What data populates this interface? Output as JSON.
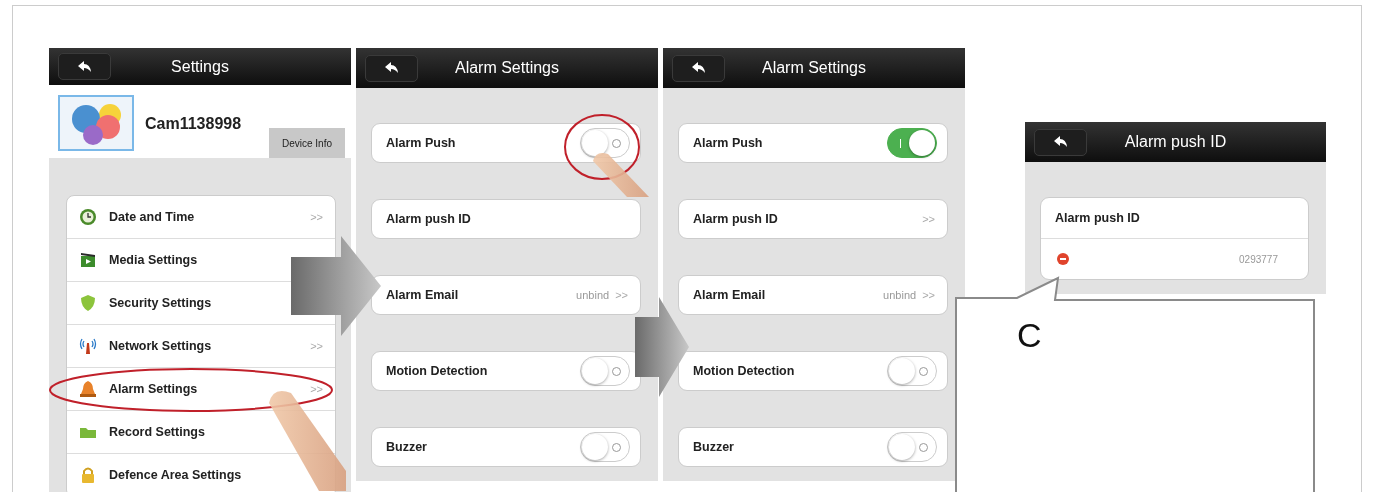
{
  "screens": [
    {
      "kind": "settings",
      "title": "Settings",
      "device": {
        "name": "Cam1138998",
        "button": "Device Info"
      },
      "items": [
        {
          "label": "Date and Time",
          "kind": "clock",
          "chevron": ">>"
        },
        {
          "label": "Media Settings",
          "kind": "media"
        },
        {
          "label": "Security Settings",
          "kind": "shield"
        },
        {
          "label": "Network Settings",
          "kind": "antenna",
          "chevron": ">>"
        },
        {
          "label": "Alarm Settings",
          "kind": "bell",
          "chevron": ">>"
        },
        {
          "label": "Record Settings",
          "kind": "folder"
        },
        {
          "label": "Defence Area Settings",
          "kind": "lock"
        }
      ]
    },
    {
      "kind": "rows",
      "title": "Alarm Settings",
      "rows": [
        {
          "label": "Alarm Push",
          "kind": "toggle",
          "on": false
        },
        {
          "label": "Alarm push ID",
          "kind": "link"
        },
        {
          "label": "Alarm Email",
          "kind": "link",
          "value": "unbind",
          "chevron": ">>"
        },
        {
          "label": "Motion Detection",
          "kind": "toggle",
          "on": false
        },
        {
          "label": "Buzzer",
          "kind": "toggle",
          "on": false
        }
      ]
    },
    {
      "kind": "rows",
      "title": "Alarm Settings",
      "rows": [
        {
          "label": "Alarm Push",
          "kind": "toggle",
          "on": true
        },
        {
          "label": "Alarm push ID",
          "kind": "link",
          "chevron": ">>"
        },
        {
          "label": "Alarm Email",
          "kind": "link",
          "value": "unbind",
          "chevron": ">>"
        },
        {
          "label": "Motion Detection",
          "kind": "toggle",
          "on": false
        },
        {
          "label": "Buzzer",
          "kind": "toggle",
          "on": false
        }
      ]
    },
    {
      "kind": "push_id",
      "title": "Alarm push ID",
      "label": "Alarm push ID",
      "entries": [
        {
          "value": "0293777"
        }
      ]
    }
  ],
  "callout": {
    "label": "C"
  }
}
